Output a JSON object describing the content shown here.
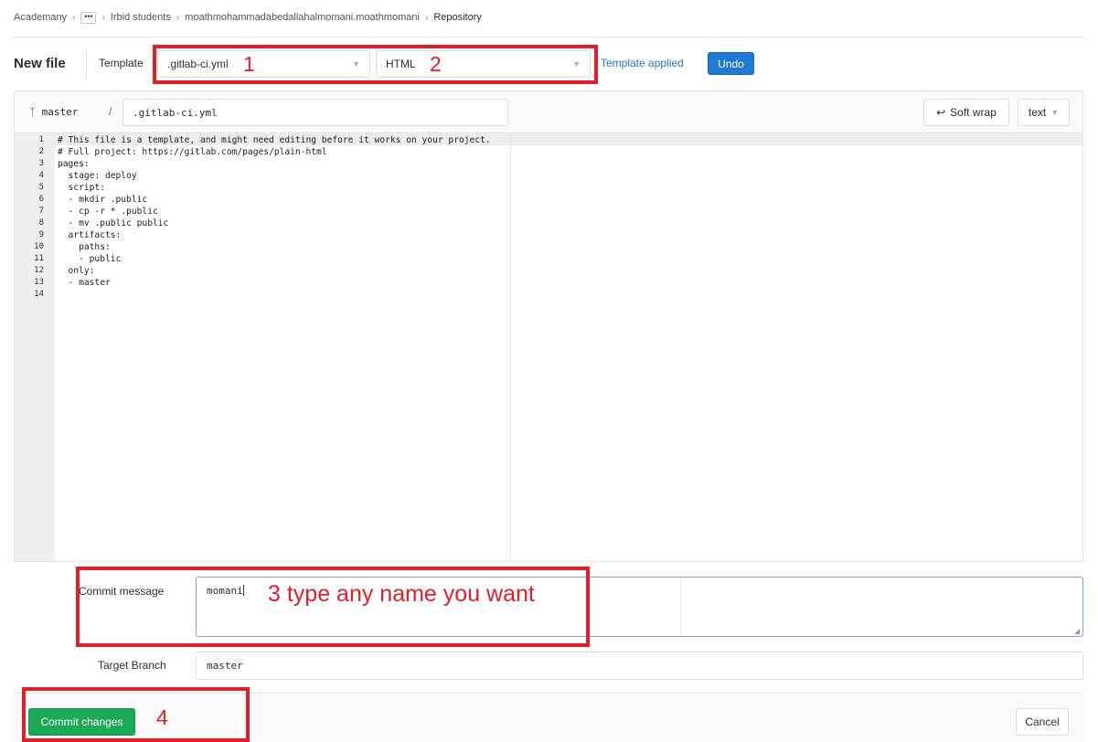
{
  "breadcrumb": {
    "items": [
      "Academany",
      "Irbid students",
      "moathmohammadabedallahalmomani.moathmomani"
    ],
    "current": "Repository",
    "ellipsis": "•••",
    "separator": "›"
  },
  "header": {
    "title": "New file",
    "template_label": "Template",
    "template_type_selected": ".gitlab-ci.yml",
    "template_selected": "HTML",
    "template_status": "Template applied",
    "undo_label": "Undo"
  },
  "editor": {
    "branch": "master",
    "path_separator": "/",
    "file_path": ".gitlab-ci.yml",
    "soft_wrap_label": "Soft wrap",
    "mode_label": "text",
    "line_numbers": [
      "1",
      "2",
      "3",
      "4",
      "5",
      "6",
      "7",
      "8",
      "9",
      "10",
      "11",
      "12",
      "13",
      "14"
    ],
    "lines": [
      "# This file is a template, and might need editing before it works on your project.",
      "# Full project: https://gitlab.com/pages/plain-html",
      "pages:",
      "  stage: deploy",
      "  script:",
      "  - mkdir .public",
      "  - cp -r * .public",
      "  - mv .public public",
      "  artifacts:",
      "    paths:",
      "    - public",
      "  only:",
      "  - master",
      ""
    ]
  },
  "commit": {
    "message_label": "Commit message",
    "message_value": "momani",
    "target_branch_label": "Target Branch",
    "target_branch_value": "master",
    "commit_button": "Commit changes",
    "cancel_button": "Cancel"
  },
  "annotations": {
    "n1": "1",
    "n2": "2",
    "n3": "3 type any name you want",
    "n4": "4",
    "color": "#e21e26"
  },
  "colors": {
    "primary_blue": "#1f78d1",
    "success_green": "#1aaa55"
  }
}
